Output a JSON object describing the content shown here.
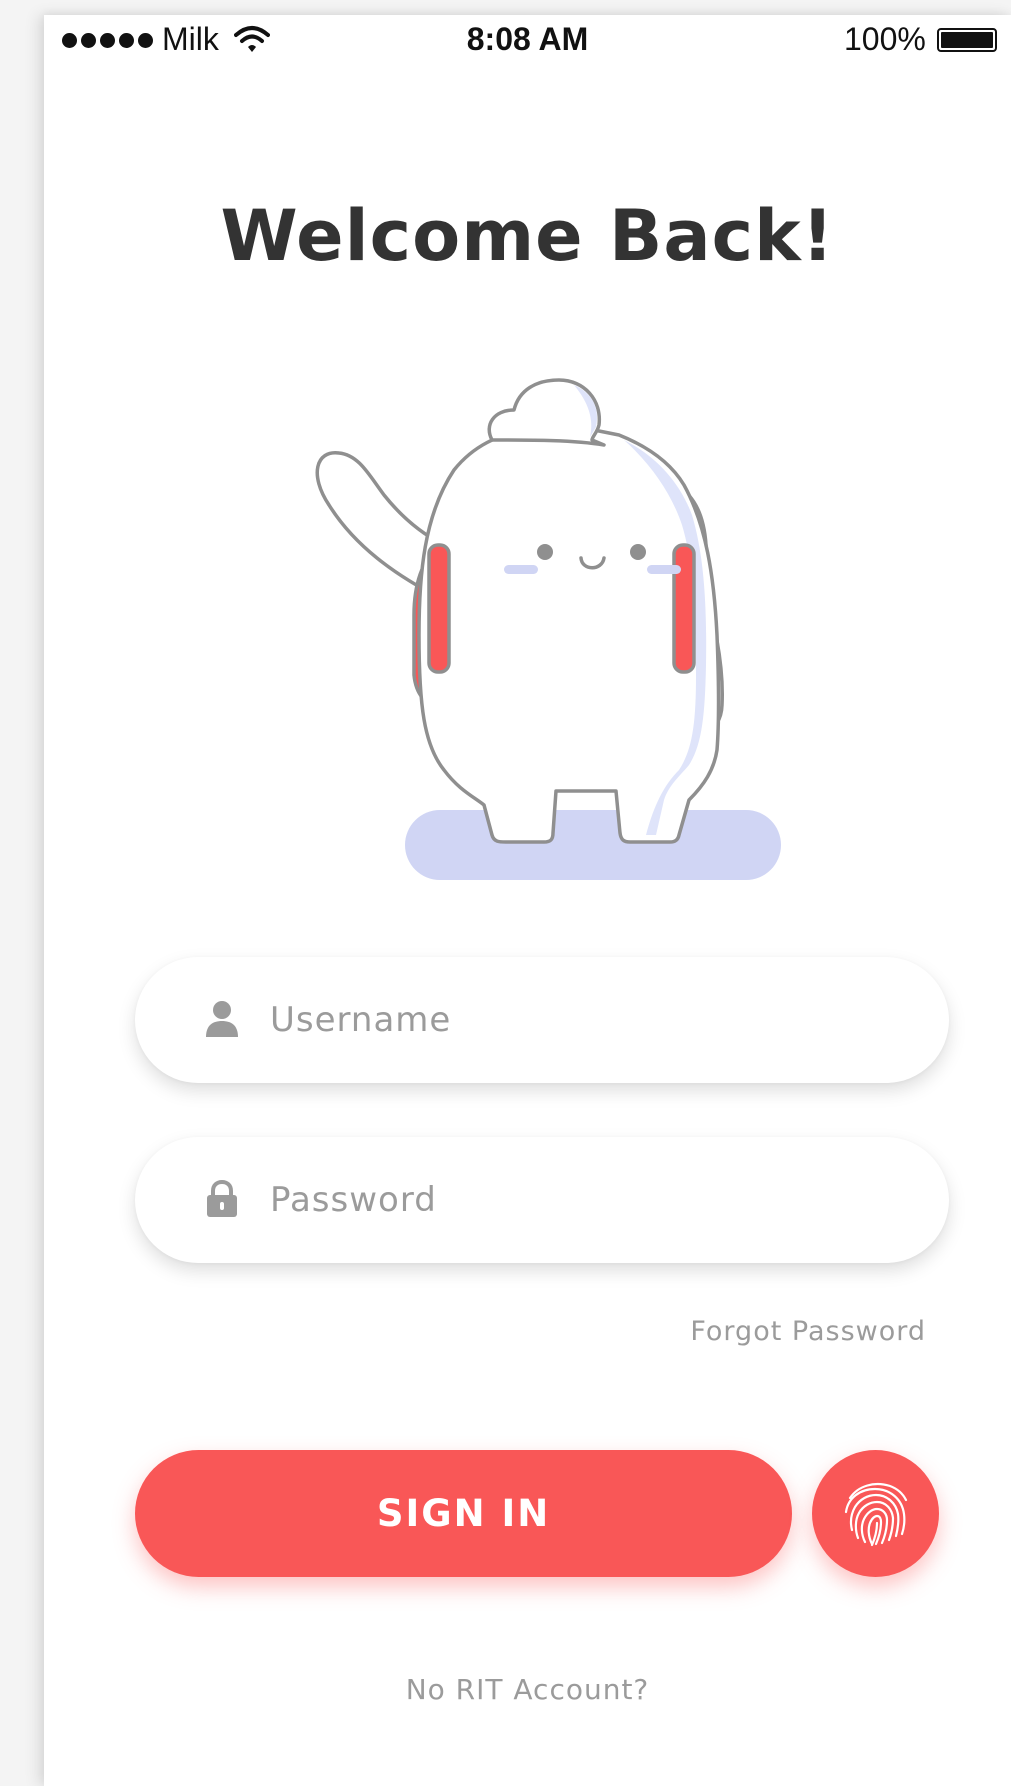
{
  "status_bar": {
    "carrier": "Milk",
    "time": "8:08 AM",
    "battery": "100%",
    "icons": [
      "signal-dots-icon",
      "wifi-icon",
      "battery-icon"
    ]
  },
  "title": "Welcome Back!",
  "illustration": {
    "name": "waving-mascot-with-headphones",
    "colors": {
      "outline": "#8f8f8f",
      "headphones": "#f95757",
      "shadow": "#d0d5f4",
      "body_shade": "#dfe4fa"
    }
  },
  "form": {
    "username": {
      "placeholder": "Username",
      "icon": "user-icon"
    },
    "password": {
      "placeholder": "Password",
      "icon": "lock-icon"
    },
    "forgot": "Forgot Password"
  },
  "actions": {
    "sign_in": "SIGN IN",
    "fingerprint_icon": "fingerprint-icon",
    "no_account": "No RIT Account?"
  },
  "colors": {
    "accent": "#f95757",
    "text_dark": "#333333",
    "text_muted": "#9b9b9b"
  }
}
